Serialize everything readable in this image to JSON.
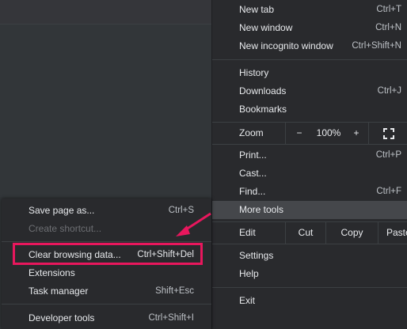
{
  "menu": {
    "new_tab": {
      "label": "New tab",
      "shortcut": "Ctrl+T"
    },
    "new_window": {
      "label": "New window",
      "shortcut": "Ctrl+N"
    },
    "new_incognito": {
      "label": "New incognito window",
      "shortcut": "Ctrl+Shift+N"
    },
    "history": {
      "label": "History"
    },
    "downloads": {
      "label": "Downloads",
      "shortcut": "Ctrl+J"
    },
    "bookmarks": {
      "label": "Bookmarks"
    },
    "zoom": {
      "label": "Zoom",
      "minus": "−",
      "value": "100%",
      "plus": "+"
    },
    "print": {
      "label": "Print...",
      "shortcut": "Ctrl+P"
    },
    "cast": {
      "label": "Cast..."
    },
    "find": {
      "label": "Find...",
      "shortcut": "Ctrl+F"
    },
    "more_tools": {
      "label": "More tools"
    },
    "edit": {
      "label": "Edit",
      "cut": "Cut",
      "copy": "Copy",
      "paste": "Paste"
    },
    "settings": {
      "label": "Settings"
    },
    "help": {
      "label": "Help"
    },
    "exit": {
      "label": "Exit"
    }
  },
  "submenu": {
    "save_page": {
      "label": "Save page as...",
      "shortcut": "Ctrl+S"
    },
    "create_shortcut": {
      "label": "Create shortcut..."
    },
    "clear_browsing": {
      "label": "Clear browsing data...",
      "shortcut": "Ctrl+Shift+Del"
    },
    "extensions": {
      "label": "Extensions"
    },
    "task_manager": {
      "label": "Task manager",
      "shortcut": "Shift+Esc"
    },
    "developer_tools": {
      "label": "Developer tools",
      "shortcut": "Ctrl+Shift+I"
    }
  },
  "icons": {
    "fullscreen": "fullscreen-icon",
    "arrow": "annotation-arrow-icon"
  },
  "colors": {
    "highlight": "#e8175d",
    "menu_bg": "#292a2d",
    "hover_bg": "#45474b"
  }
}
